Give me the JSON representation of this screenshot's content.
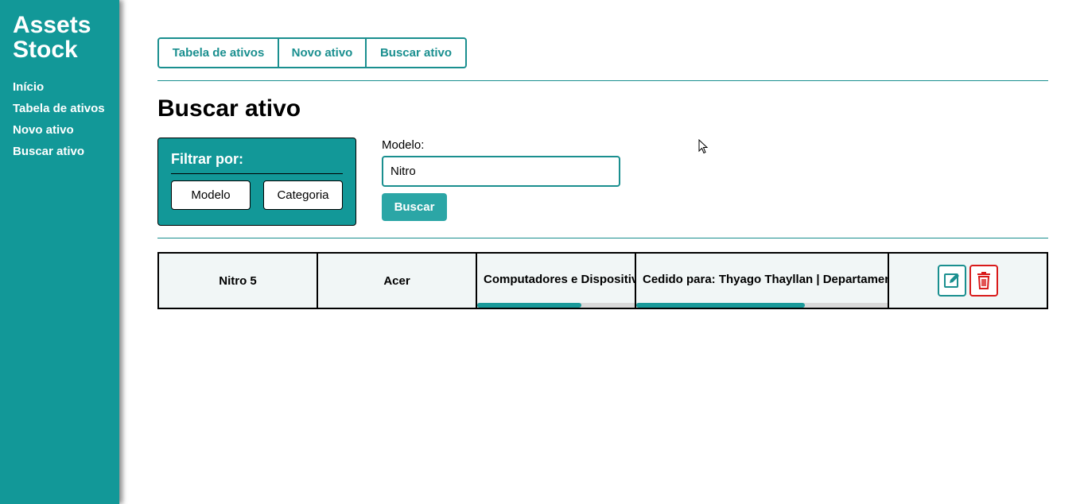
{
  "brand": {
    "line1": "Assets",
    "line2": "Stock"
  },
  "sidebar": {
    "items": [
      {
        "label": "Início"
      },
      {
        "label": "Tabela de ativos"
      },
      {
        "label": "Novo ativo"
      },
      {
        "label": "Buscar ativo"
      }
    ]
  },
  "tabs": [
    {
      "label": "Tabela de ativos"
    },
    {
      "label": "Novo ativo"
    },
    {
      "label": "Buscar ativo"
    }
  ],
  "page_title": "Buscar ativo",
  "filter": {
    "title": "Filtrar por:",
    "options": [
      {
        "label": "Modelo"
      },
      {
        "label": "Categoria"
      }
    ]
  },
  "search": {
    "label": "Modelo:",
    "value": "Nitro",
    "button": "Buscar"
  },
  "results": [
    {
      "model": "Nitro 5",
      "brand": "Acer",
      "category": "Computadores e Dispositivos",
      "status": "Cedido para: Thyago Thayllan | Departamento",
      "category_scroll": 0.66,
      "status_scroll": 0.67
    }
  ],
  "colors": {
    "primary": "#129898",
    "accent": "#1a8f8f",
    "danger": "#d91a1a"
  },
  "icons": {
    "edit": "edit-icon",
    "delete": "trash-icon",
    "cursor": "mouse-cursor-icon"
  }
}
